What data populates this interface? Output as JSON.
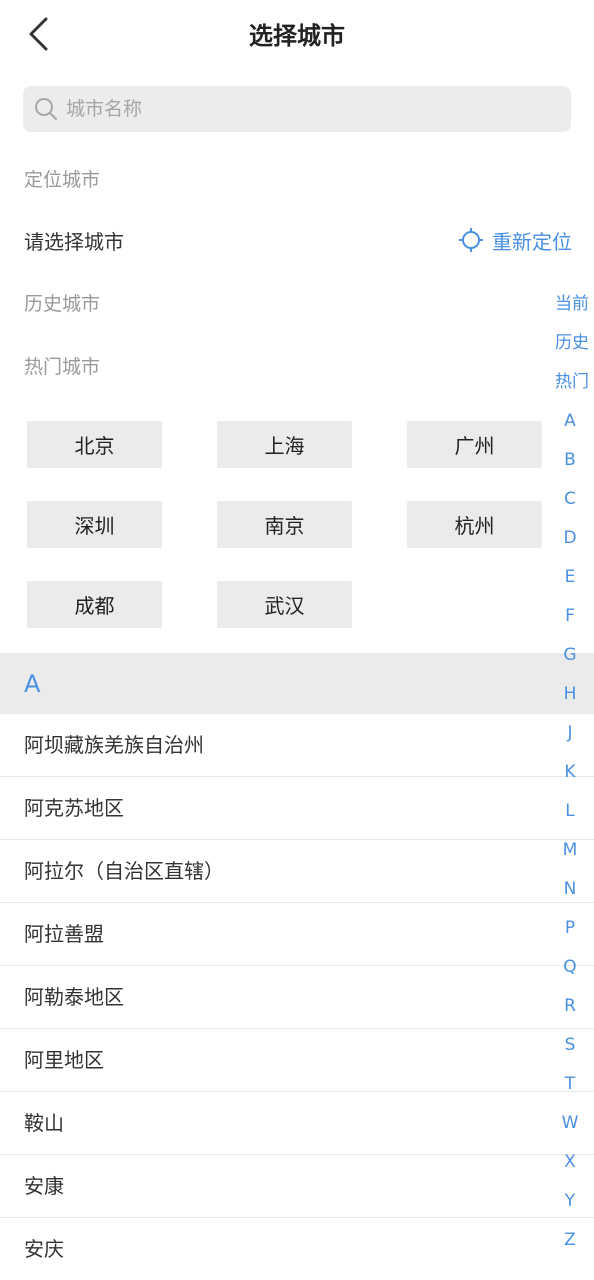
{
  "header": {
    "title": "选择城市"
  },
  "search": {
    "placeholder": "城市名称",
    "value": ""
  },
  "sections": {
    "located_label": "定位城市",
    "located_value": "请选择城市",
    "relocate_label": "重新定位",
    "history_label": "历史城市",
    "hot_label": "热门城市"
  },
  "hot_cities": [
    "北京",
    "上海",
    "广州",
    "深圳",
    "南京",
    "杭州",
    "成都",
    "武汉"
  ],
  "letter_group": "A",
  "city_list": [
    "阿坝藏族羌族自治州",
    "阿克苏地区",
    "阿拉尔（自治区直辖）",
    "阿拉善盟",
    "阿勒泰地区",
    "阿里地区",
    "鞍山",
    "安康",
    "安庆"
  ],
  "alpha_index": [
    "当前",
    "历史",
    "热门",
    "A",
    "B",
    "C",
    "D",
    "E",
    "F",
    "G",
    "H",
    "J",
    "K",
    "L",
    "M",
    "N",
    "P",
    "Q",
    "R",
    "S",
    "T",
    "W",
    "X",
    "Y",
    "Z"
  ],
  "colors": {
    "accent": "#4a90e2",
    "chip_bg": "#ebebeb",
    "muted_text": "#9a9a9a"
  },
  "icons": {
    "back": "chevron-left-icon",
    "search": "search-icon",
    "relocate": "crosshair-icon"
  }
}
